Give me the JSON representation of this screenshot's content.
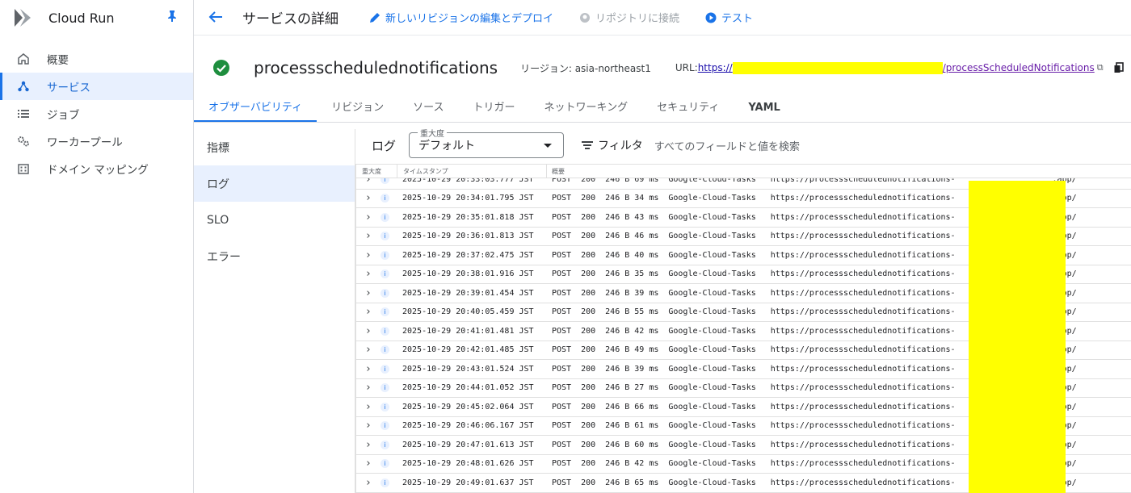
{
  "app": {
    "product_name": "Cloud Run"
  },
  "nav": {
    "items": [
      {
        "label": "概要",
        "icon": "home-icon"
      },
      {
        "label": "サービス",
        "icon": "services-icon",
        "active": true
      },
      {
        "label": "ジョブ",
        "icon": "list-icon"
      },
      {
        "label": "ワーカープール",
        "icon": "gears-icon"
      },
      {
        "label": "ドメイン マッピング",
        "icon": "domain-icon"
      }
    ]
  },
  "topbar": {
    "title": "サービスの詳細",
    "edit_deploy": "新しいリビジョンの編集とデプロイ",
    "connect_repo": "リポジトリに接続",
    "test": "テスト"
  },
  "service": {
    "name": "processschedulednotifications",
    "region": "リージョン: asia-northeast1",
    "url_label": "URL:",
    "url_prefix": "https://",
    "url_suffix": "/processScheduledNotifications"
  },
  "tabs": [
    "オブザーバビリティ",
    "リビジョン",
    "ソース",
    "トリガー",
    "ネットワーキング",
    "セキュリティ",
    "YAML"
  ],
  "subnav": [
    "指標",
    "ログ",
    "SLO",
    "エラー"
  ],
  "logs": {
    "label": "ログ",
    "severity_legend": "重大度",
    "severity_value": "デフォルト",
    "filter_label": "フィルタ",
    "search_hint": "すべてのフィールドと値を検索",
    "columns": {
      "severity": "重大度",
      "timestamp": "タイムスタンプ",
      "summary": "概要"
    },
    "rows": [
      {
        "ts": "2025-10-29 20:33:03.777 JST",
        "ms": "69 ms"
      },
      {
        "ts": "2025-10-29 20:34:01.795 JST",
        "ms": "34 ms"
      },
      {
        "ts": "2025-10-29 20:35:01.818 JST",
        "ms": "43 ms"
      },
      {
        "ts": "2025-10-29 20:36:01.813 JST",
        "ms": "46 ms"
      },
      {
        "ts": "2025-10-29 20:37:02.475 JST",
        "ms": "40 ms"
      },
      {
        "ts": "2025-10-29 20:38:01.916 JST",
        "ms": "35 ms"
      },
      {
        "ts": "2025-10-29 20:39:01.454 JST",
        "ms": "39 ms"
      },
      {
        "ts": "2025-10-29 20:40:05.459 JST",
        "ms": "55 ms"
      },
      {
        "ts": "2025-10-29 20:41:01.481 JST",
        "ms": "42 ms"
      },
      {
        "ts": "2025-10-29 20:42:01.485 JST",
        "ms": "49 ms"
      },
      {
        "ts": "2025-10-29 20:43:01.524 JST",
        "ms": "39 ms"
      },
      {
        "ts": "2025-10-29 20:44:01.052 JST",
        "ms": "27 ms"
      },
      {
        "ts": "2025-10-29 20:45:02.064 JST",
        "ms": "66 ms"
      },
      {
        "ts": "2025-10-29 20:46:06.167 JST",
        "ms": "61 ms"
      },
      {
        "ts": "2025-10-29 20:47:01.613 JST",
        "ms": "60 ms"
      },
      {
        "ts": "2025-10-29 20:48:01.626 JST",
        "ms": "42 ms"
      },
      {
        "ts": "2025-10-29 20:49:01.637 JST",
        "ms": "65 ms"
      }
    ],
    "row_common": {
      "method": "POST",
      "status": "200",
      "size": "246 B",
      "agent": "Google-Cloud-Tasks",
      "url_prefix": "https://processschedulednotifications-",
      "url_suffix": ".app/"
    }
  },
  "colors": {
    "accent": "#1a73e8",
    "redaction": "#ffff00",
    "success": "#1e8e3e"
  }
}
